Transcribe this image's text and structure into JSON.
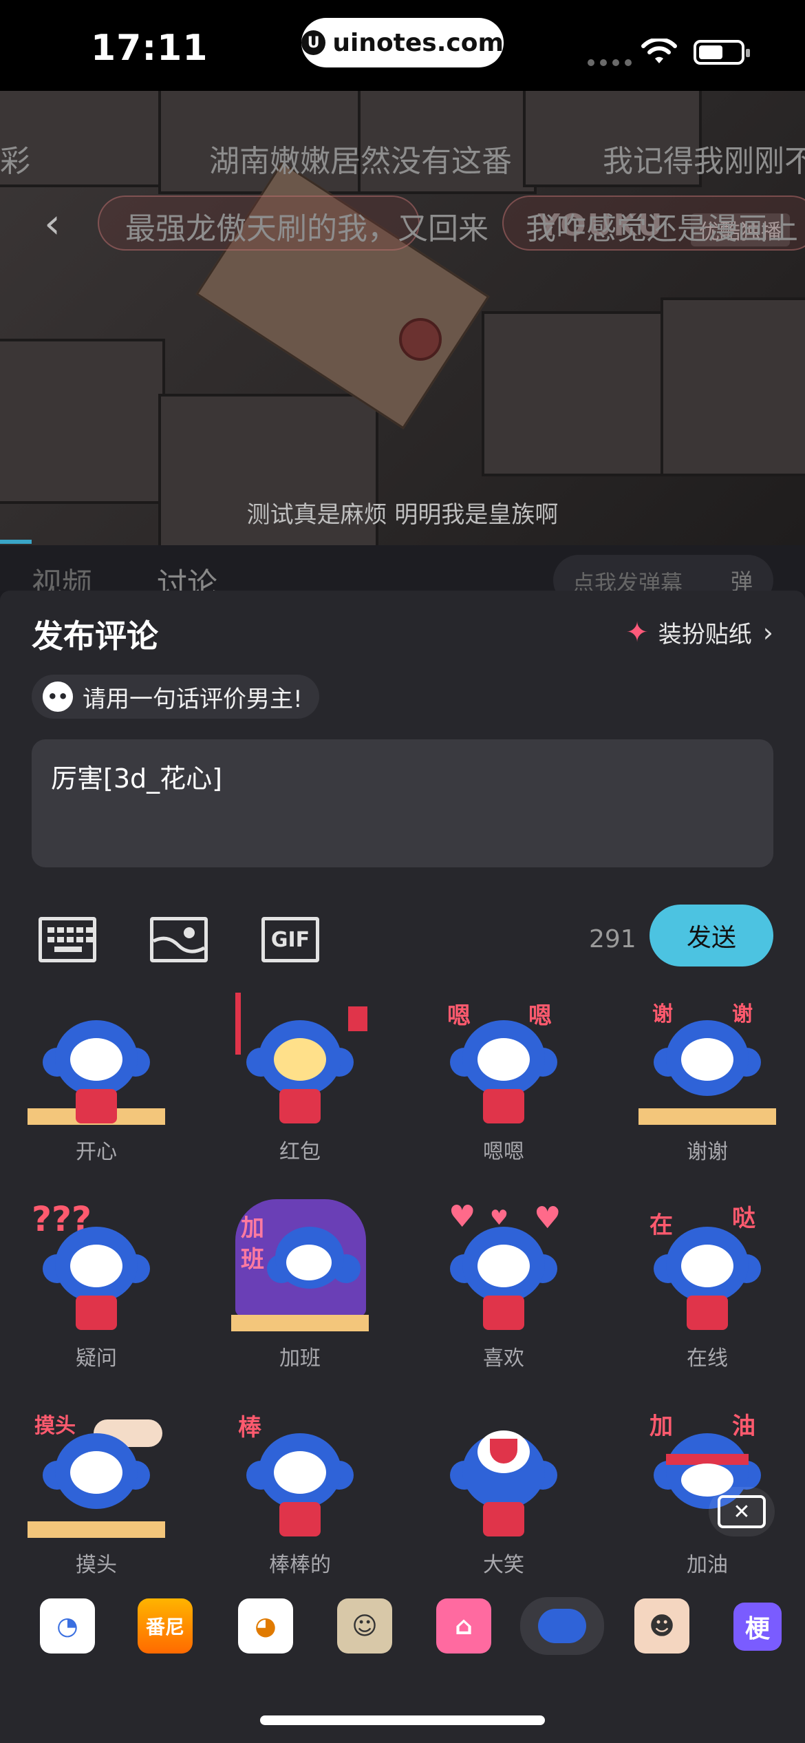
{
  "status_bar": {
    "time": "17:11",
    "url": "uinotes.com",
    "url_icon": "U"
  },
  "video": {
    "logo": "YOUKU",
    "exclusive_badge": "优酷独播",
    "danmu": [
      {
        "text": "湖南嫩嫩居然没有这番"
      },
      {
        "text": "我记得我刚刚不"
      },
      {
        "text": "最强龙傲天刷的我，又回来"
      },
      {
        "text": "我咋感觉还是漫画上"
      },
      {
        "text": "彩"
      }
    ],
    "subtitle": "测试真是麻烦 明明我是皇族啊"
  },
  "tabs_peek": {
    "video_tab": "视频",
    "discuss_tab": "讨论",
    "danmu_input": "点我发弹幕",
    "danmu_toggle": "弹"
  },
  "sheet": {
    "title": "发布评论",
    "dress_sticker": "装扮贴纸",
    "prompt": "请用一句话评价男主!",
    "input_value": "厉害[3d_花心]",
    "char_count": "291",
    "send_label": "发送",
    "gif_label": "GIF"
  },
  "stickers": [
    {
      "label": "开心",
      "words": []
    },
    {
      "label": "红包",
      "words": []
    },
    {
      "label": "嗯嗯",
      "words": [
        "嗯",
        "嗯"
      ]
    },
    {
      "label": "谢谢",
      "words": [
        "谢",
        "谢"
      ]
    },
    {
      "label": "疑问",
      "words": [
        "???"
      ]
    },
    {
      "label": "加班",
      "words": [
        "加",
        "班"
      ]
    },
    {
      "label": "喜欢",
      "words": []
    },
    {
      "label": "在线",
      "words": [
        "在",
        "哒"
      ]
    },
    {
      "label": "摸头",
      "words": [
        "摸头"
      ]
    },
    {
      "label": "棒棒的",
      "words": [
        "棒"
      ]
    },
    {
      "label": "大笑",
      "words": []
    },
    {
      "label": "加油",
      "words": [
        "加",
        "油"
      ]
    }
  ],
  "packs": [
    {
      "name": "pack-1"
    },
    {
      "name": "pack-2",
      "text": "番尼"
    },
    {
      "name": "pack-3"
    },
    {
      "name": "pack-4"
    },
    {
      "name": "pack-5"
    },
    {
      "name": "pack-6-selected"
    },
    {
      "name": "pack-7"
    },
    {
      "name": "pack-8",
      "text": "梗"
    }
  ],
  "colors": {
    "accent_send": "#4cc3e1",
    "sheet_bg": "#27272c",
    "wand": "#ff5a7a"
  }
}
